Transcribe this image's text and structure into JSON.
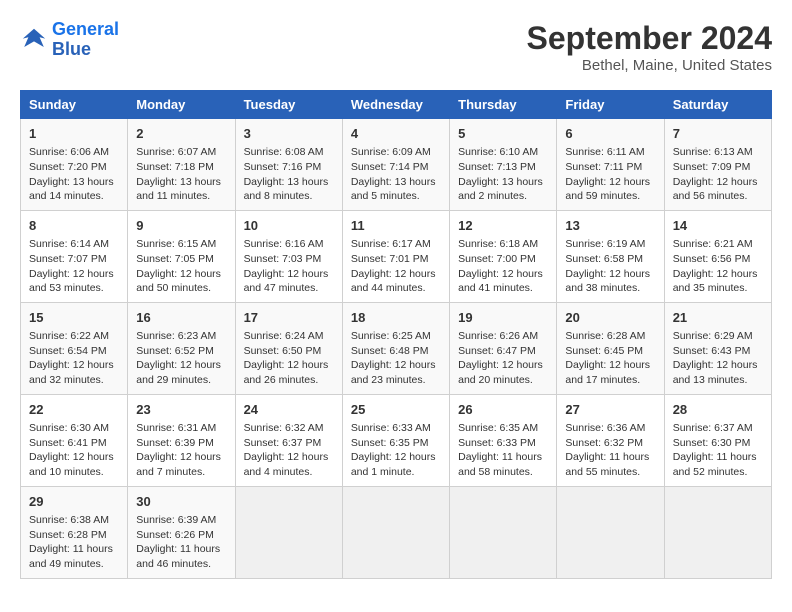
{
  "header": {
    "logo_line1": "General",
    "logo_line2": "Blue",
    "month_year": "September 2024",
    "location": "Bethel, Maine, United States"
  },
  "days_of_week": [
    "Sunday",
    "Monday",
    "Tuesday",
    "Wednesday",
    "Thursday",
    "Friday",
    "Saturday"
  ],
  "weeks": [
    [
      {
        "day": "1",
        "info": "Sunrise: 6:06 AM\nSunset: 7:20 PM\nDaylight: 13 hours\nand 14 minutes."
      },
      {
        "day": "2",
        "info": "Sunrise: 6:07 AM\nSunset: 7:18 PM\nDaylight: 13 hours\nand 11 minutes."
      },
      {
        "day": "3",
        "info": "Sunrise: 6:08 AM\nSunset: 7:16 PM\nDaylight: 13 hours\nand 8 minutes."
      },
      {
        "day": "4",
        "info": "Sunrise: 6:09 AM\nSunset: 7:14 PM\nDaylight: 13 hours\nand 5 minutes."
      },
      {
        "day": "5",
        "info": "Sunrise: 6:10 AM\nSunset: 7:13 PM\nDaylight: 13 hours\nand 2 minutes."
      },
      {
        "day": "6",
        "info": "Sunrise: 6:11 AM\nSunset: 7:11 PM\nDaylight: 12 hours\nand 59 minutes."
      },
      {
        "day": "7",
        "info": "Sunrise: 6:13 AM\nSunset: 7:09 PM\nDaylight: 12 hours\nand 56 minutes."
      }
    ],
    [
      {
        "day": "8",
        "info": "Sunrise: 6:14 AM\nSunset: 7:07 PM\nDaylight: 12 hours\nand 53 minutes."
      },
      {
        "day": "9",
        "info": "Sunrise: 6:15 AM\nSunset: 7:05 PM\nDaylight: 12 hours\nand 50 minutes."
      },
      {
        "day": "10",
        "info": "Sunrise: 6:16 AM\nSunset: 7:03 PM\nDaylight: 12 hours\nand 47 minutes."
      },
      {
        "day": "11",
        "info": "Sunrise: 6:17 AM\nSunset: 7:01 PM\nDaylight: 12 hours\nand 44 minutes."
      },
      {
        "day": "12",
        "info": "Sunrise: 6:18 AM\nSunset: 7:00 PM\nDaylight: 12 hours\nand 41 minutes."
      },
      {
        "day": "13",
        "info": "Sunrise: 6:19 AM\nSunset: 6:58 PM\nDaylight: 12 hours\nand 38 minutes."
      },
      {
        "day": "14",
        "info": "Sunrise: 6:21 AM\nSunset: 6:56 PM\nDaylight: 12 hours\nand 35 minutes."
      }
    ],
    [
      {
        "day": "15",
        "info": "Sunrise: 6:22 AM\nSunset: 6:54 PM\nDaylight: 12 hours\nand 32 minutes."
      },
      {
        "day": "16",
        "info": "Sunrise: 6:23 AM\nSunset: 6:52 PM\nDaylight: 12 hours\nand 29 minutes."
      },
      {
        "day": "17",
        "info": "Sunrise: 6:24 AM\nSunset: 6:50 PM\nDaylight: 12 hours\nand 26 minutes."
      },
      {
        "day": "18",
        "info": "Sunrise: 6:25 AM\nSunset: 6:48 PM\nDaylight: 12 hours\nand 23 minutes."
      },
      {
        "day": "19",
        "info": "Sunrise: 6:26 AM\nSunset: 6:47 PM\nDaylight: 12 hours\nand 20 minutes."
      },
      {
        "day": "20",
        "info": "Sunrise: 6:28 AM\nSunset: 6:45 PM\nDaylight: 12 hours\nand 17 minutes."
      },
      {
        "day": "21",
        "info": "Sunrise: 6:29 AM\nSunset: 6:43 PM\nDaylight: 12 hours\nand 13 minutes."
      }
    ],
    [
      {
        "day": "22",
        "info": "Sunrise: 6:30 AM\nSunset: 6:41 PM\nDaylight: 12 hours\nand 10 minutes."
      },
      {
        "day": "23",
        "info": "Sunrise: 6:31 AM\nSunset: 6:39 PM\nDaylight: 12 hours\nand 7 minutes."
      },
      {
        "day": "24",
        "info": "Sunrise: 6:32 AM\nSunset: 6:37 PM\nDaylight: 12 hours\nand 4 minutes."
      },
      {
        "day": "25",
        "info": "Sunrise: 6:33 AM\nSunset: 6:35 PM\nDaylight: 12 hours\nand 1 minute."
      },
      {
        "day": "26",
        "info": "Sunrise: 6:35 AM\nSunset: 6:33 PM\nDaylight: 11 hours\nand 58 minutes."
      },
      {
        "day": "27",
        "info": "Sunrise: 6:36 AM\nSunset: 6:32 PM\nDaylight: 11 hours\nand 55 minutes."
      },
      {
        "day": "28",
        "info": "Sunrise: 6:37 AM\nSunset: 6:30 PM\nDaylight: 11 hours\nand 52 minutes."
      }
    ],
    [
      {
        "day": "29",
        "info": "Sunrise: 6:38 AM\nSunset: 6:28 PM\nDaylight: 11 hours\nand 49 minutes."
      },
      {
        "day": "30",
        "info": "Sunrise: 6:39 AM\nSunset: 6:26 PM\nDaylight: 11 hours\nand 46 minutes."
      },
      {
        "day": "",
        "info": ""
      },
      {
        "day": "",
        "info": ""
      },
      {
        "day": "",
        "info": ""
      },
      {
        "day": "",
        "info": ""
      },
      {
        "day": "",
        "info": ""
      }
    ]
  ]
}
